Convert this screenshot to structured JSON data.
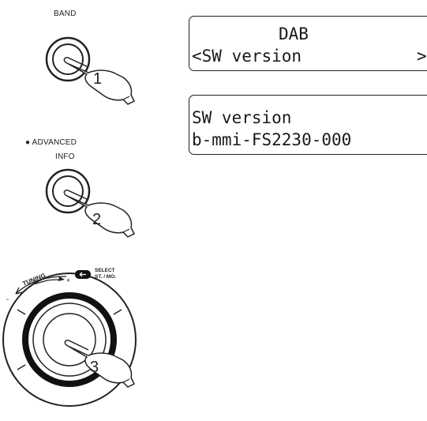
{
  "steps": [
    {
      "button_label": "BAND",
      "number": "1"
    },
    {
      "button_label_top": "● ADVANCED",
      "button_label_bottom": "INFO",
      "number": "2"
    },
    {
      "dial_label": "TUNING",
      "select_label_top": "SELECT",
      "select_label_bottom": "ST. / MO.",
      "minus": "-",
      "plus": "+",
      "number": "3"
    }
  ],
  "displays": [
    {
      "line1": "DAB",
      "line2": "<SW version",
      "line2_right": ">"
    },
    {
      "line1": "SW version",
      "line2": "b-mmi-FS2230-000"
    }
  ]
}
